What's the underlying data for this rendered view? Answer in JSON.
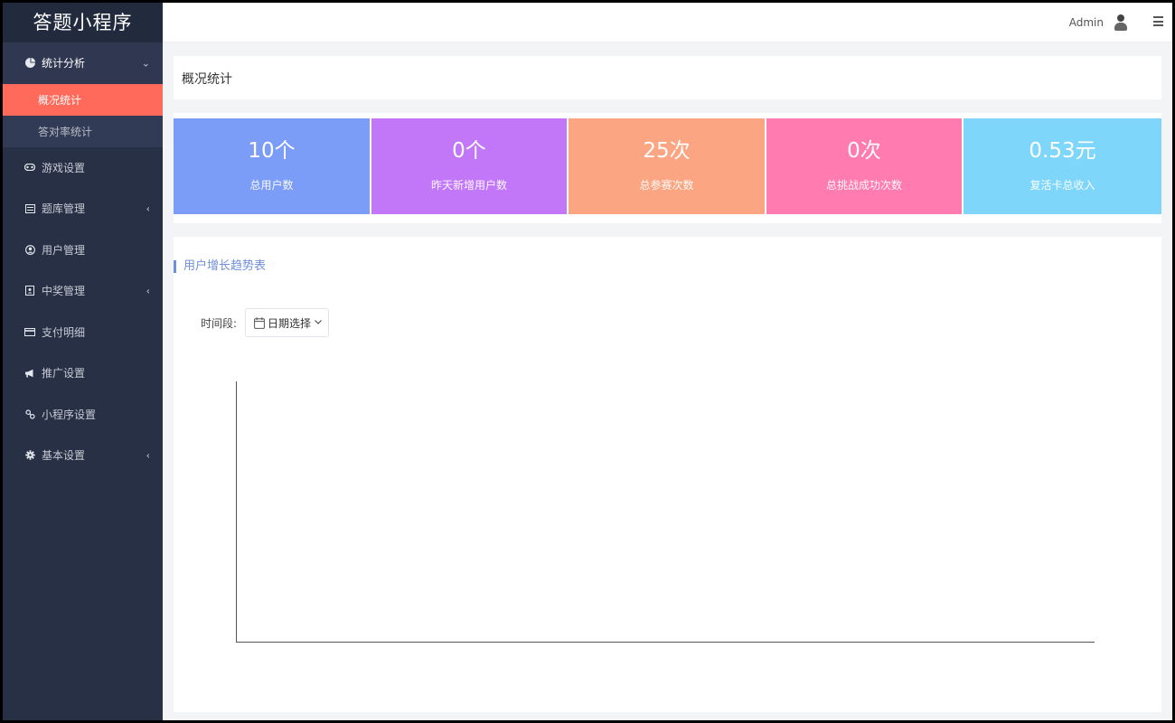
{
  "sidebar": {
    "brand": "答题小程序",
    "menu": [
      {
        "label": "统计分析",
        "icon": "pie-chart-icon",
        "arrow": "⌄"
      },
      {
        "label": "游戏设置",
        "icon": "gamepad-icon",
        "arrow": ""
      },
      {
        "label": "题库管理",
        "icon": "list-icon",
        "arrow": "‹"
      },
      {
        "label": "用户管理",
        "icon": "user-circle-icon",
        "arrow": ""
      },
      {
        "label": "中奖管理",
        "icon": "contact-card-icon",
        "arrow": "‹"
      },
      {
        "label": "支付明细",
        "icon": "credit-card-icon",
        "arrow": ""
      },
      {
        "label": "推广设置",
        "icon": "megaphone-icon",
        "arrow": ""
      },
      {
        "label": "小程序设置",
        "icon": "link-icon",
        "arrow": ""
      },
      {
        "label": "基本设置",
        "icon": "gear-icon",
        "arrow": "‹"
      }
    ],
    "submenu": [
      {
        "label": "概况统计",
        "active": true
      },
      {
        "label": "答对率统计",
        "active": false
      }
    ]
  },
  "topbar": {
    "user": "Admin"
  },
  "page_title": "概况统计",
  "stats": [
    {
      "value": "10个",
      "label": "总用户数",
      "color": "#7b9cf7"
    },
    {
      "value": "0个",
      "label": "昨天新增用户数",
      "color": "#c177f7"
    },
    {
      "value": "25次",
      "label": "总参赛次数",
      "color": "#fca582"
    },
    {
      "value": "0次",
      "label": "总挑战成功次数",
      "color": "#ff7bb0"
    },
    {
      "value": "0.53元",
      "label": "复活卡总收入",
      "color": "#7fd6fb"
    }
  ],
  "chart_panel": {
    "title": "用户增长趋势表",
    "period_label": "时间段:",
    "date_button": "日期选择"
  },
  "chart_data": {
    "type": "line",
    "series": [],
    "grid": false
  }
}
